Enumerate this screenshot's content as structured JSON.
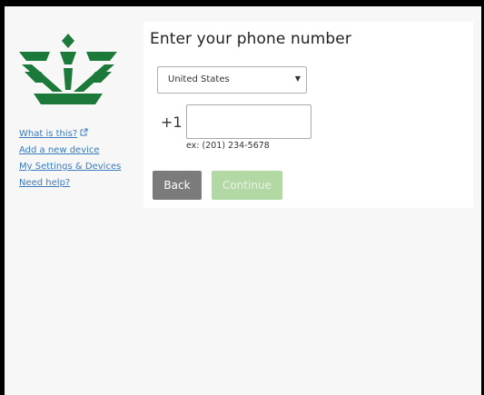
{
  "colors": {
    "brand_green": "#1b7a3a",
    "link": "#3a7bbd",
    "back_button": "#7b7b7b",
    "continue_button_disabled": "#b2d9a4",
    "panel_bg": "#ffffff",
    "page_bg": "#f7f7f7"
  },
  "sidebar": {
    "logo_icon": "university-crest-icon",
    "links": [
      {
        "label": "What is this?",
        "icon": "external-link-icon"
      },
      {
        "label": "Add a new device"
      },
      {
        "label": "My Settings & Devices"
      },
      {
        "label": "Need help?"
      }
    ]
  },
  "form": {
    "title": "Enter your phone number",
    "country_select": {
      "selected": "United States"
    },
    "country_code": "+1",
    "phone_input": {
      "value": "",
      "placeholder": ""
    },
    "example": "ex: (201) 234-5678",
    "back_label": "Back",
    "continue_label": "Continue",
    "continue_disabled": true
  }
}
